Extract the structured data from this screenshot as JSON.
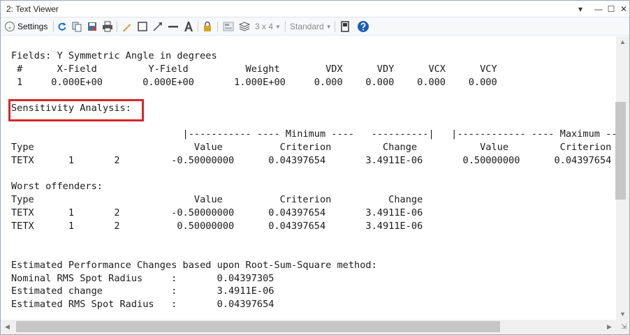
{
  "window": {
    "title": "2: Text Viewer"
  },
  "toolbar": {
    "settings_label": "Settings",
    "grid_label": "3 x 4",
    "style_label": "Standard"
  },
  "content": {
    "lines": [
      "Fields: Y Symmetric Angle in degrees",
      " #      X-Field         Y-Field          Weight        VDX      VDY      VCX      VCY",
      " 1     0.000E+00       0.000E+00       1.000E+00     0.000    0.000    0.000    0.000",
      "",
      "Sensitivity Analysis:",
      "",
      "                              |----------- ---- Minimum ----   ----------|   |------------ ---- Maximum ----",
      "Type                            Value          Criterion         Change           Value         Criterion",
      "TETX      1       2         -0.50000000      0.04397654       3.4911E-06       0.50000000      0.04397654",
      "",
      "Worst offenders:",
      "Type                            Value          Criterion          Change",
      "TETX      1       2         -0.50000000      0.04397654       3.4911E-06",
      "TETX      1       2          0.50000000      0.04397654       3.4911E-06",
      "",
      "",
      "Estimated Performance Changes based upon Root-Sum-Square method:",
      "Nominal RMS Spot Radius     :       0.04397305",
      "Estimated change            :       3.4911E-06",
      "Estimated RMS Spot Radius   :       0.04397654"
    ]
  }
}
